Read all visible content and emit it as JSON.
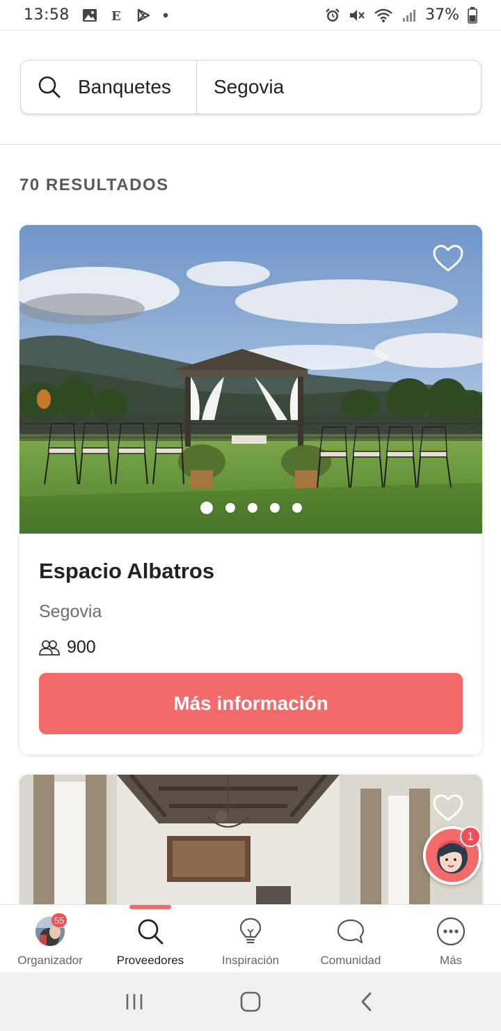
{
  "status_bar": {
    "time": "13:58",
    "battery": "37%"
  },
  "search": {
    "category": "Banquetes",
    "location": "Segovia"
  },
  "results": {
    "count_label": "70 RESULTADOS"
  },
  "cards": [
    {
      "name": "Espacio Albatros",
      "location": "Segovia",
      "capacity": "900",
      "cta_label": "Más información",
      "photo_count": 5,
      "active_photo": 1
    }
  ],
  "assistant": {
    "badge": "1"
  },
  "bottom_nav": {
    "items": [
      {
        "label": "Organizador",
        "badge": "55"
      },
      {
        "label": "Proveedores"
      },
      {
        "label": "Inspiración"
      },
      {
        "label": "Comunidad"
      },
      {
        "label": "Más"
      }
    ],
    "active_index": 1
  },
  "colors": {
    "accent": "#f26a6a",
    "badge": "#ef4e5a"
  }
}
